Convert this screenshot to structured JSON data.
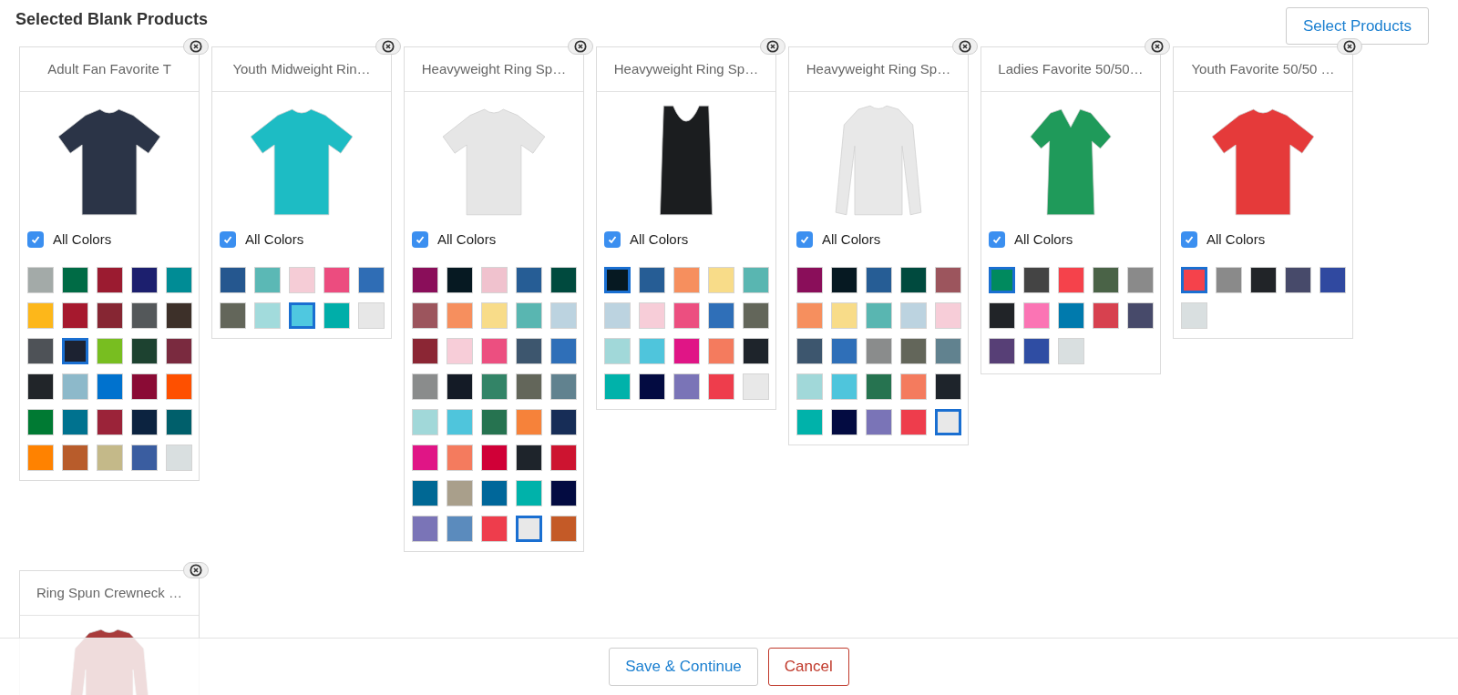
{
  "title": "Selected Blank Products",
  "select_button": "Select Products",
  "products": [
    {
      "name": "Adult Fan Favorite T",
      "garment": {
        "kind": "tee",
        "color": "#2b3447"
      },
      "all_colors": {
        "label": "All Colors",
        "checked": true
      },
      "swatches": [
        {
          "color": "#a3aaa8",
          "selected": false
        },
        {
          "color": "#006b45",
          "selected": false
        },
        {
          "color": "#9b1b30",
          "selected": false
        },
        {
          "color": "#1c1f6e",
          "selected": false
        },
        {
          "color": "#008c95",
          "selected": false
        },
        {
          "color": "#fdb71a",
          "selected": false
        },
        {
          "color": "#a6192e",
          "selected": false
        },
        {
          "color": "#862633",
          "selected": false
        },
        {
          "color": "#54585a",
          "selected": false
        },
        {
          "color": "#3d3029",
          "selected": false
        },
        {
          "color": "#4e5257",
          "selected": false
        },
        {
          "color": "#1c2231",
          "selected": true
        },
        {
          "color": "#78be20",
          "selected": false
        },
        {
          "color": "#1d4230",
          "selected": false
        },
        {
          "color": "#7a2a3f",
          "selected": false
        },
        {
          "color": "#212529",
          "selected": false
        },
        {
          "color": "#8db9ca",
          "selected": false
        },
        {
          "color": "#0072ce",
          "selected": false
        },
        {
          "color": "#8a0b35",
          "selected": false
        },
        {
          "color": "#fe5000",
          "selected": false
        },
        {
          "color": "#007a33",
          "selected": false
        },
        {
          "color": "#00728f",
          "selected": false
        },
        {
          "color": "#9b2339",
          "selected": false
        },
        {
          "color": "#0c2340",
          "selected": false
        },
        {
          "color": "#005f6b",
          "selected": false
        },
        {
          "color": "#ff8200",
          "selected": false
        },
        {
          "color": "#b85c2b",
          "selected": false
        },
        {
          "color": "#c4b989",
          "selected": false
        },
        {
          "color": "#3a5da0",
          "selected": false
        },
        {
          "color": "#d9dfe0",
          "selected": false
        }
      ]
    },
    {
      "name": "Youth Midweight Rin…",
      "garment": {
        "kind": "tee",
        "color": "#1dbcc4"
      },
      "all_colors": {
        "label": "All Colors",
        "checked": true
      },
      "swatches": [
        {
          "color": "#25578f",
          "selected": false
        },
        {
          "color": "#5bb8b5",
          "selected": false
        },
        {
          "color": "#f5ccd6",
          "selected": false
        },
        {
          "color": "#ec4c7f",
          "selected": false
        },
        {
          "color": "#2f6db5",
          "selected": false
        },
        {
          "color": "#63665a",
          "selected": false
        },
        {
          "color": "#a2dbdc",
          "selected": false
        },
        {
          "color": "#4fc8e0",
          "selected": true
        },
        {
          "color": "#00aea9",
          "selected": false
        },
        {
          "color": "#e7e7e7",
          "selected": false
        }
      ]
    },
    {
      "name": "Heavyweight Ring Sp…",
      "garment": {
        "kind": "tee",
        "color": "#e6e6e6"
      },
      "all_colors": {
        "label": "All Colors",
        "checked": true
      },
      "swatches": [
        {
          "color": "#8a0e5a",
          "selected": false
        },
        {
          "color": "#061922",
          "selected": false
        },
        {
          "color": "#f0c2ce",
          "selected": false
        },
        {
          "color": "#265d95",
          "selected": false
        },
        {
          "color": "#004a3e",
          "selected": false
        },
        {
          "color": "#9c555d",
          "selected": false
        },
        {
          "color": "#f68f5e",
          "selected": false
        },
        {
          "color": "#f8dc89",
          "selected": false
        },
        {
          "color": "#59b6b1",
          "selected": false
        },
        {
          "color": "#bcd3e0",
          "selected": false
        },
        {
          "color": "#8b2634",
          "selected": false
        },
        {
          "color": "#f7cdd8",
          "selected": false
        },
        {
          "color": "#ec4f80",
          "selected": false
        },
        {
          "color": "#3d566e",
          "selected": false
        },
        {
          "color": "#2f6fb8",
          "selected": false
        },
        {
          "color": "#8a8c8c",
          "selected": false
        },
        {
          "color": "#141b26",
          "selected": false
        },
        {
          "color": "#338467",
          "selected": false
        },
        {
          "color": "#63665a",
          "selected": false
        },
        {
          "color": "#61828f",
          "selected": false
        },
        {
          "color": "#a1d8d9",
          "selected": false
        },
        {
          "color": "#4fc5dc",
          "selected": false
        },
        {
          "color": "#267350",
          "selected": false
        },
        {
          "color": "#f6823a",
          "selected": false
        },
        {
          "color": "#172d57",
          "selected": false
        },
        {
          "color": "#e01586",
          "selected": false
        },
        {
          "color": "#f47b5e",
          "selected": false
        },
        {
          "color": "#d00037",
          "selected": false
        },
        {
          "color": "#1e242b",
          "selected": false
        },
        {
          "color": "#cd1430",
          "selected": false
        },
        {
          "color": "#006894",
          "selected": false
        },
        {
          "color": "#a99f8b",
          "selected": false
        },
        {
          "color": "#00679a",
          "selected": false
        },
        {
          "color": "#00b2aa",
          "selected": false
        },
        {
          "color": "#030b41",
          "selected": false
        },
        {
          "color": "#7a74b7",
          "selected": false
        },
        {
          "color": "#5b8bbd",
          "selected": false
        },
        {
          "color": "#ee3d4c",
          "selected": false
        },
        {
          "color": "#e8e8e8",
          "selected": true
        },
        {
          "color": "#c45a27",
          "selected": false
        }
      ]
    },
    {
      "name": "Heavyweight Ring Sp…",
      "garment": {
        "kind": "tank",
        "color": "#1b1d1f"
      },
      "all_colors": {
        "label": "All Colors",
        "checked": true
      },
      "swatches": [
        {
          "color": "#061922",
          "selected": true
        },
        {
          "color": "#265d95",
          "selected": false
        },
        {
          "color": "#f68f5e",
          "selected": false
        },
        {
          "color": "#f8dc89",
          "selected": false
        },
        {
          "color": "#59b6b1",
          "selected": false
        },
        {
          "color": "#bcd3e0",
          "selected": false
        },
        {
          "color": "#f7cdd8",
          "selected": false
        },
        {
          "color": "#ec4f80",
          "selected": false
        },
        {
          "color": "#2f6fb8",
          "selected": false
        },
        {
          "color": "#63665a",
          "selected": false
        },
        {
          "color": "#a1d8d9",
          "selected": false
        },
        {
          "color": "#4fc5dc",
          "selected": false
        },
        {
          "color": "#e01586",
          "selected": false
        },
        {
          "color": "#f47b5e",
          "selected": false
        },
        {
          "color": "#1e242b",
          "selected": false
        },
        {
          "color": "#00b2aa",
          "selected": false
        },
        {
          "color": "#030b41",
          "selected": false
        },
        {
          "color": "#7a74b7",
          "selected": false
        },
        {
          "color": "#ee3d4c",
          "selected": false
        },
        {
          "color": "#e8e8e8",
          "selected": false
        }
      ]
    },
    {
      "name": "Heavyweight Ring Sp…",
      "garment": {
        "kind": "longsleeve",
        "color": "#e8e8e8"
      },
      "all_colors": {
        "label": "All Colors",
        "checked": true
      },
      "swatches": [
        {
          "color": "#8a0e5a",
          "selected": false
        },
        {
          "color": "#061922",
          "selected": false
        },
        {
          "color": "#265d95",
          "selected": false
        },
        {
          "color": "#004a3e",
          "selected": false
        },
        {
          "color": "#9c555d",
          "selected": false
        },
        {
          "color": "#f68f5e",
          "selected": false
        },
        {
          "color": "#f8dc89",
          "selected": false
        },
        {
          "color": "#59b6b1",
          "selected": false
        },
        {
          "color": "#bcd3e0",
          "selected": false
        },
        {
          "color": "#f7cdd8",
          "selected": false
        },
        {
          "color": "#3d566e",
          "selected": false
        },
        {
          "color": "#2f6fb8",
          "selected": false
        },
        {
          "color": "#8a8c8c",
          "selected": false
        },
        {
          "color": "#63665a",
          "selected": false
        },
        {
          "color": "#61828f",
          "selected": false
        },
        {
          "color": "#a1d8d9",
          "selected": false
        },
        {
          "color": "#4fc5dc",
          "selected": false
        },
        {
          "color": "#267350",
          "selected": false
        },
        {
          "color": "#f47b5e",
          "selected": false
        },
        {
          "color": "#1e242b",
          "selected": false
        },
        {
          "color": "#00b2aa",
          "selected": false
        },
        {
          "color": "#030b41",
          "selected": false
        },
        {
          "color": "#7a74b7",
          "selected": false
        },
        {
          "color": "#ee3d4c",
          "selected": false
        },
        {
          "color": "#e8e8e8",
          "selected": true
        }
      ]
    },
    {
      "name": "Ladies Favorite 50/50…",
      "garment": {
        "kind": "vneck",
        "color": "#1f9a5a"
      },
      "all_colors": {
        "label": "All Colors",
        "checked": true
      },
      "swatches": [
        {
          "color": "#008a5e",
          "selected": true
        },
        {
          "color": "#444444",
          "selected": false
        },
        {
          "color": "#f5424b",
          "selected": false
        },
        {
          "color": "#4a6347",
          "selected": false
        },
        {
          "color": "#8a8a8a",
          "selected": false
        },
        {
          "color": "#212428",
          "selected": false
        },
        {
          "color": "#fb74b4",
          "selected": false
        },
        {
          "color": "#007aad",
          "selected": false
        },
        {
          "color": "#d7414f",
          "selected": false
        },
        {
          "color": "#474a6a",
          "selected": false
        },
        {
          "color": "#573f76",
          "selected": false
        },
        {
          "color": "#2f4da3",
          "selected": false
        },
        {
          "color": "#d9dfe0",
          "selected": false
        }
      ]
    },
    {
      "name": "Youth Favorite 50/50 …",
      "garment": {
        "kind": "tee",
        "color": "#e53a3a"
      },
      "all_colors": {
        "label": "All Colors",
        "checked": true
      },
      "swatches": [
        {
          "color": "#f5424b",
          "selected": true
        },
        {
          "color": "#8a8a8a",
          "selected": false
        },
        {
          "color": "#212428",
          "selected": false
        },
        {
          "color": "#474a6a",
          "selected": false
        },
        {
          "color": "#3049a0",
          "selected": false
        },
        {
          "color": "#d9dfe0",
          "selected": false
        }
      ]
    },
    {
      "name": "Ring Spun Crewneck …",
      "garment": {
        "kind": "longsleeve",
        "color": "#a83c3c"
      }
    }
  ],
  "footer": {
    "save_button": "Save & Continue",
    "cancel_button": "Cancel"
  }
}
